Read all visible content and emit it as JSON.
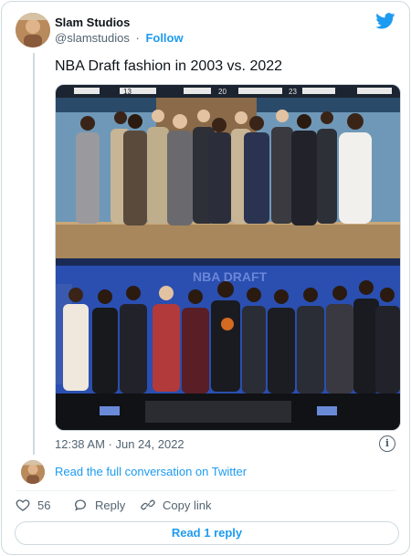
{
  "author": {
    "name": "Slam Studios",
    "handle": "@slamstudios",
    "separator": "·",
    "follow_label": "Follow"
  },
  "tweet": {
    "text": "NBA Draft fashion in 2003 vs. 2022",
    "timestamp": "12:38 AM · Jun 24, 2022",
    "info_glyph": "i"
  },
  "media": {
    "top_photo_banner_numbers": [
      "13",
      "20",
      "23"
    ],
    "bottom_photo_banner_text": "NBA DRAFT"
  },
  "conversation": {
    "link_label": "Read the full conversation on Twitter"
  },
  "actions": {
    "like_count": "56",
    "reply_label": "Reply",
    "copy_link_label": "Copy link"
  },
  "footer": {
    "read_replies_label": "Read 1 reply"
  },
  "colors": {
    "accent": "#1d9bf0",
    "text_secondary": "#536471",
    "border": "#cfd9de"
  }
}
